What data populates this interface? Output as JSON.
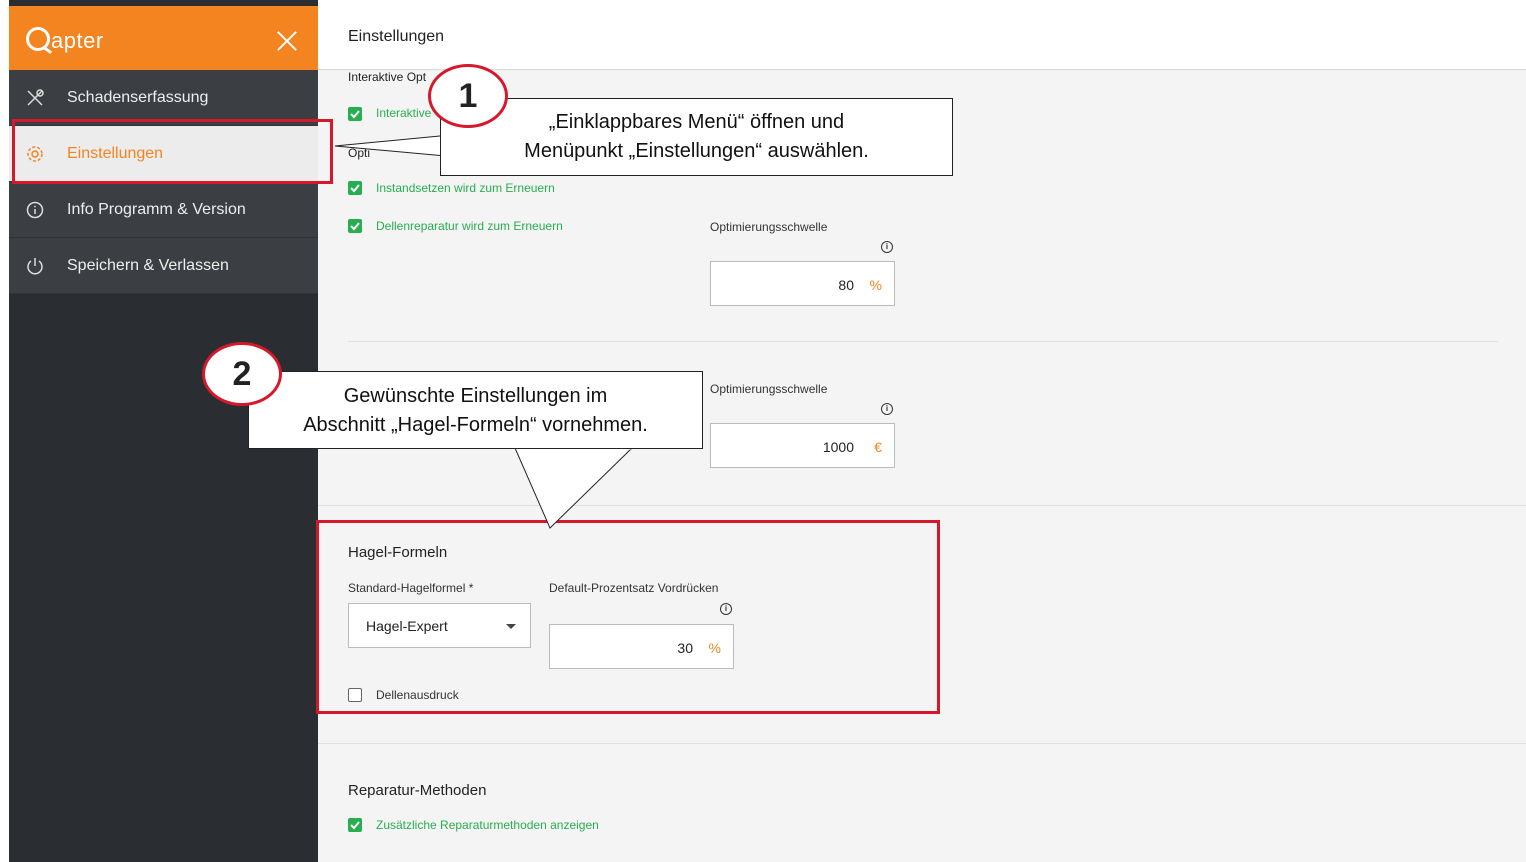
{
  "app": {
    "logo_text": "apter",
    "close_icon": "close-icon"
  },
  "sidebar": {
    "items": [
      {
        "label": "Schadenserfassung",
        "icon": "tools-icon"
      },
      {
        "label": "Einstellungen",
        "icon": "gear-icon",
        "active": true
      },
      {
        "label": "Info Programm & Version",
        "icon": "info-icon"
      },
      {
        "label": "Speichern & Verlassen",
        "icon": "power-icon"
      }
    ]
  },
  "header": {
    "title": "Einstellungen"
  },
  "optimization": {
    "partial_heading": "Interaktive Opt",
    "interactive_partial_label": "Interaktive",
    "partial_label_2": "Opti",
    "checkbox1": "Instandsetzen wird zum Erneuern",
    "checkbox2": "Dellenreparatur wird zum Erneuern",
    "threshold_label": "Optimierungsschwelle",
    "threshold_value": "80",
    "threshold_unit": "%",
    "threshold2_label": "Optimierungsschwelle",
    "threshold2_value": "1000",
    "threshold2_unit": "€"
  },
  "hagel": {
    "title": "Hagel-Formeln",
    "formula_label": "Standard-Hagelformel *",
    "formula_value": "Hagel-Expert",
    "percent_label": "Default-Prozentsatz Vordrücken",
    "percent_value": "30",
    "percent_unit": "%",
    "checkbox_label": "Dellenausdruck",
    "checkbox_checked": false
  },
  "repair": {
    "title": "Reparatur-Methoden",
    "checkbox_label": "Zusätzliche Reparaturmethoden anzeigen"
  },
  "annotations": {
    "badge1": "1",
    "callout1_line1": "„Einklappbares Menü“ öffnen und",
    "callout1_line2": "Menüpunkt „Einstellungen“ auswählen.",
    "badge2": "2",
    "callout2_line1": "Gewünschte Einstellungen im",
    "callout2_line2": "Abschnitt „Hagel-Formeln“ vornehmen."
  },
  "colors": {
    "accent": "#f4841f",
    "sidebar": "#2a2d31",
    "check": "#27ae4f",
    "highlight": "#d6182b"
  }
}
